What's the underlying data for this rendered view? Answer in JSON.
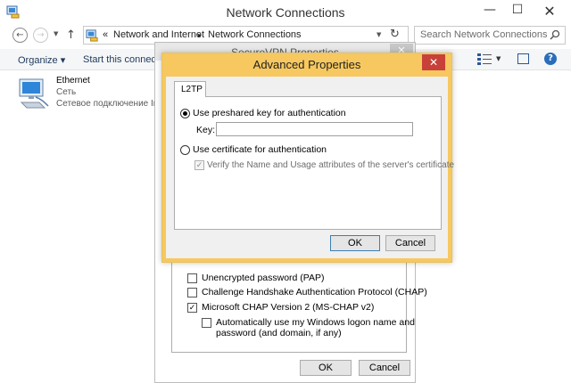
{
  "window": {
    "title": "Network Connections",
    "controls": {
      "minimize": "—",
      "maximize": "☐",
      "close": "✕"
    }
  },
  "nav": {
    "back": "←",
    "forward": "→",
    "recent_dropdown": "▼",
    "up": "↑",
    "address_prefix": "«",
    "breadcrumb": [
      "Network and Internet",
      "Network Connections"
    ],
    "breadcrumb_sep": "▸",
    "address_dropdown": "▼",
    "refresh": "↻",
    "search_placeholder": "Search Network Connections"
  },
  "toolbar": {
    "organize": "Organize ▾",
    "start_connection": "Start this connecti",
    "view_dropdown": "▼",
    "help": "?"
  },
  "connections": [
    {
      "name": "Ethernet",
      "status": "Сеть",
      "device": "Сетевое подключение In"
    }
  ],
  "vpn_dialog": {
    "title": "SecureVPN Properties",
    "close": "✕",
    "auth_options": [
      {
        "label": "Unencrypted password (PAP)",
        "checked": false
      },
      {
        "label": "Challenge Handshake Authentication Protocol (CHAP)",
        "checked": false
      },
      {
        "label": "Microsoft CHAP Version 2 (MS-CHAP v2)",
        "checked": true
      }
    ],
    "auto_logon": {
      "line1": "Automatically use my Windows logon name and",
      "line2": "password (and domain, if any)",
      "checked": false
    },
    "ok": "OK",
    "cancel": "Cancel"
  },
  "adv_dialog": {
    "title": "Advanced Properties",
    "close": "✕",
    "tab": "L2TP",
    "radio_psk": "Use preshared key for authentication",
    "key_label": "Key:",
    "key_value": "",
    "radio_cert": "Use certificate for authentication",
    "verify_label": "Verify the Name and Usage attributes of the server's certificate",
    "selected": "psk",
    "ok": "OK",
    "cancel": "Cancel"
  },
  "colors": {
    "accent_title": "#f6c85f",
    "close_red": "#c7413a",
    "link_blue": "#1e395b"
  },
  "icons": {
    "app": "network-connections-icon",
    "ethernet": "network-adapter-icon",
    "search": "search-icon",
    "view": "view-options-icon",
    "pane": "preview-pane-icon",
    "help": "help-icon"
  }
}
